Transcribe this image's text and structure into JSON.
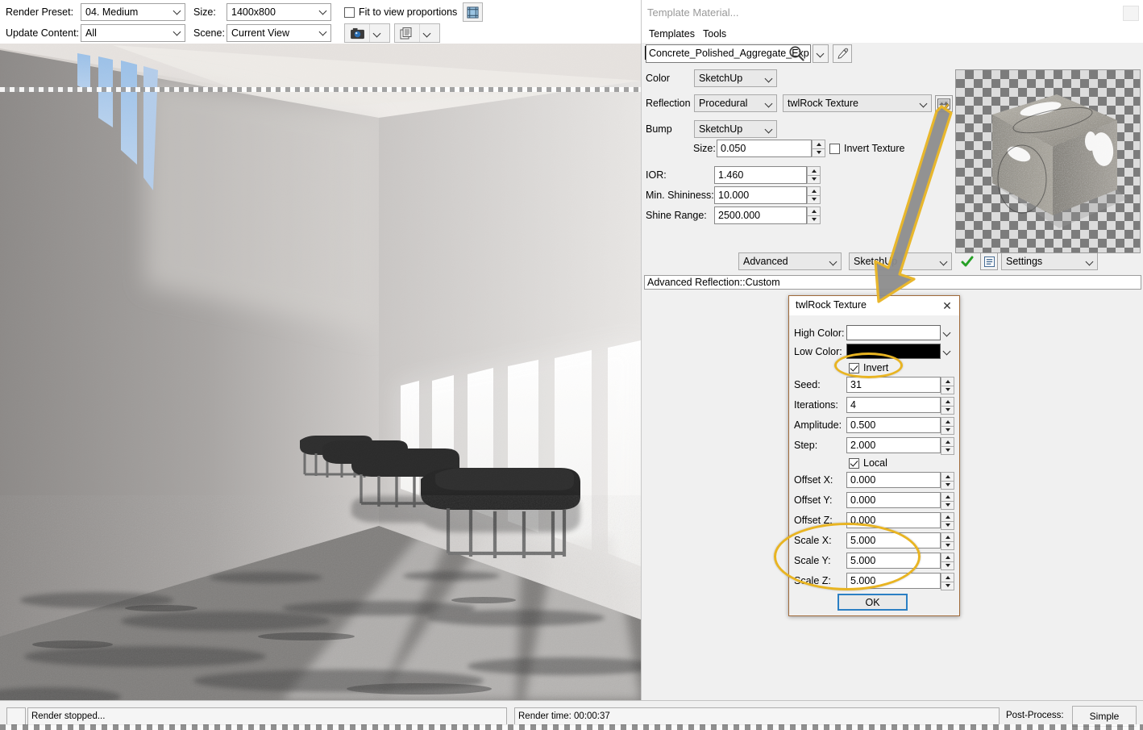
{
  "toolbar": {
    "render_preset_label": "Render Preset:",
    "render_preset_value": "04. Medium",
    "size_label": "Size:",
    "size_value": "1400x800",
    "fit_label": "Fit to view proportions",
    "update_content_label": "Update Content:",
    "update_content_value": "All",
    "scene_label": "Scene:",
    "scene_value": "Current View",
    "render_button_icon": "camera-render-icon",
    "batch_button_icon": "batch-documents-icon",
    "fit_crop_button_icon": "fit-crop-icon"
  },
  "material_panel": {
    "title": "Template Material...",
    "menus": [
      "Templates",
      "Tools"
    ],
    "search_value": "Concrete_Polished_Aggregate_Exp",
    "search_icon": "magnifier-icon",
    "eyedropper_icon": "eyedropper-icon",
    "rows": {
      "color_label": "Color",
      "color_value": "SketchUp",
      "reflection_label": "Reflection",
      "reflection_type": "Procedural",
      "reflection_texture": "twlRock Texture",
      "edit_texture_icon": "edit-texture-icon",
      "bump_label": "Bump",
      "bump_value": "SketchUp",
      "size_label": "Size:",
      "size_value": "0.050",
      "invert_texture_label": "Invert Texture",
      "ior_label": "IOR:",
      "ior_value": "1.460",
      "min_shininess_label": "Min. Shininess:",
      "min_shininess_value": "10.000",
      "shine_range_label": "Shine Range:",
      "shine_range_value": "2500.000"
    },
    "bottom": {
      "mode_value": "Advanced",
      "engine_value": "SketchUp",
      "apply_icon": "green-check-icon",
      "list_icon": "list-icon",
      "settings_value": "Settings"
    },
    "status_text": "Advanced Reflection::Custom",
    "preview_alt": "material-preview-cube-on-checkerboard"
  },
  "rock_dialog": {
    "title": "twlRock Texture",
    "close_icon": "close-icon",
    "high_color_label": "High Color:",
    "high_color_value": "#ffffff",
    "low_color_label": "Low Color:",
    "low_color_value": "#000000",
    "invert_label": "Invert",
    "invert_checked": true,
    "fields": [
      {
        "label": "Seed:",
        "value": "31"
      },
      {
        "label": "Iterations:",
        "value": "4"
      },
      {
        "label": "Amplitude:",
        "value": "0.500"
      },
      {
        "label": "Step:",
        "value": "2.000"
      }
    ],
    "local_label": "Local",
    "local_checked": true,
    "transform_fields": [
      {
        "label": "Offset X:",
        "value": "0.000"
      },
      {
        "label": "Offset Y:",
        "value": "0.000"
      },
      {
        "label": "Offset Z:",
        "value": "0.000"
      },
      {
        "label": "Scale X:",
        "value": "5.000"
      },
      {
        "label": "Scale Y:",
        "value": "5.000"
      },
      {
        "label": "Scale Z:",
        "value": "5.000"
      }
    ],
    "ok_label": "OK"
  },
  "status_bar": {
    "render_status": "Render stopped...",
    "render_time": "Render time: 00:00:37",
    "post_process_label": "Post-Process:",
    "post_process_value": "Simple"
  },
  "annotations": {
    "highlight_color": "#e8b422",
    "arrow_name": "edit-texture-to-dialog-arrow",
    "ellipse_invert_name": "invert-checkbox-highlight",
    "ellipse_scale_name": "scale-fields-highlight"
  },
  "viewport": {
    "scene_description": "interior-corridor-render-polished-concrete-floor-benches"
  }
}
